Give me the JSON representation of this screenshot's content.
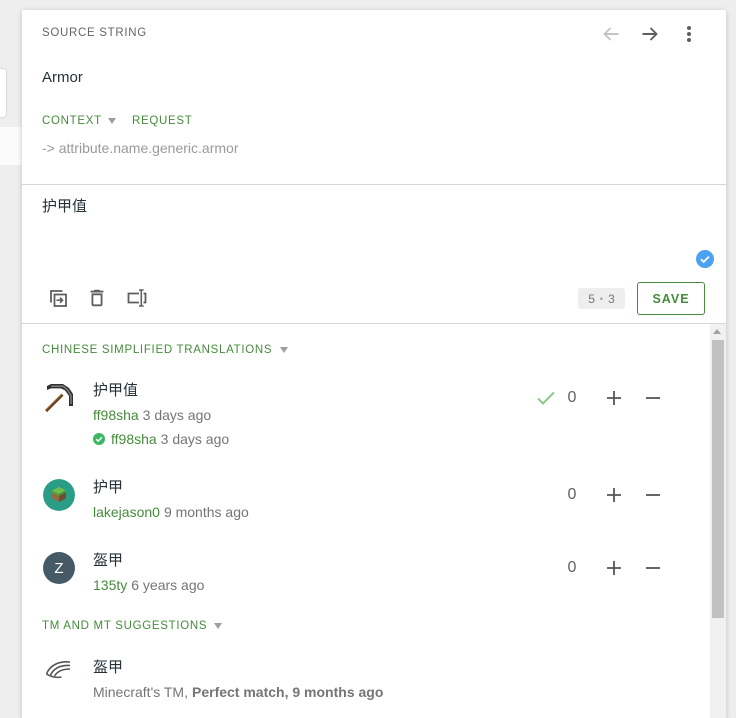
{
  "source": {
    "label": "SOURCE STRING",
    "text": "Armor",
    "tabs": [
      {
        "label": "CONTEXT",
        "icon": "caret-down-icon"
      },
      {
        "label": "REQUEST"
      }
    ],
    "context": "-> attribute.name.generic.armor",
    "nav": {
      "previous_icon": "arrow-left-icon",
      "next_icon": "arrow-right-icon",
      "menu_icon": "more-vertical-icon"
    }
  },
  "editor": {
    "value": "护甲值",
    "status_icon": "check-circle-icon",
    "tools": [
      {
        "icon": "copy-source-icon"
      },
      {
        "icon": "delete-icon"
      },
      {
        "icon": "text-cursor-box-icon"
      }
    ],
    "counter": {
      "source": "5",
      "separator": "•",
      "translation": "3"
    },
    "save_label": "SAVE"
  },
  "translations": {
    "heading": "CHINESE SIMPLIFIED TRANSLATIONS",
    "heading_icon": "caret-down-icon",
    "items": [
      {
        "avatar": "pickaxe-image",
        "text": "护甲值",
        "user": "ff98sha",
        "time": "3 days ago",
        "approved": true,
        "approved_by": "ff98sha",
        "approved_time": "3 days ago",
        "votes": "0"
      },
      {
        "avatar": "grass-block-image",
        "text": "护甲",
        "user": "lakejason0",
        "time": "9 months ago",
        "approved": false,
        "votes": "0"
      },
      {
        "avatar": "letter-avatar",
        "avatar_letter": "Z",
        "text": "盔甲",
        "user": "135ty",
        "time": "6 years ago",
        "approved": false,
        "votes": "0"
      }
    ]
  },
  "suggestions": {
    "heading": "TM AND MT SUGGESTIONS",
    "heading_icon": "caret-down-icon",
    "items": [
      {
        "icon": "translation-memory-icon",
        "text": "盔甲",
        "source": "Minecraft's TM,",
        "detail": "Perfect match, 9 months ago"
      }
    ]
  },
  "colors": {
    "accent_green": "#468b3c",
    "text_muted": "#757575",
    "status_blue": "#4ba2f2",
    "approved_green": "#3cb764",
    "avatar_slate": "#455a64",
    "avatar_teal": "#2a9d86"
  }
}
